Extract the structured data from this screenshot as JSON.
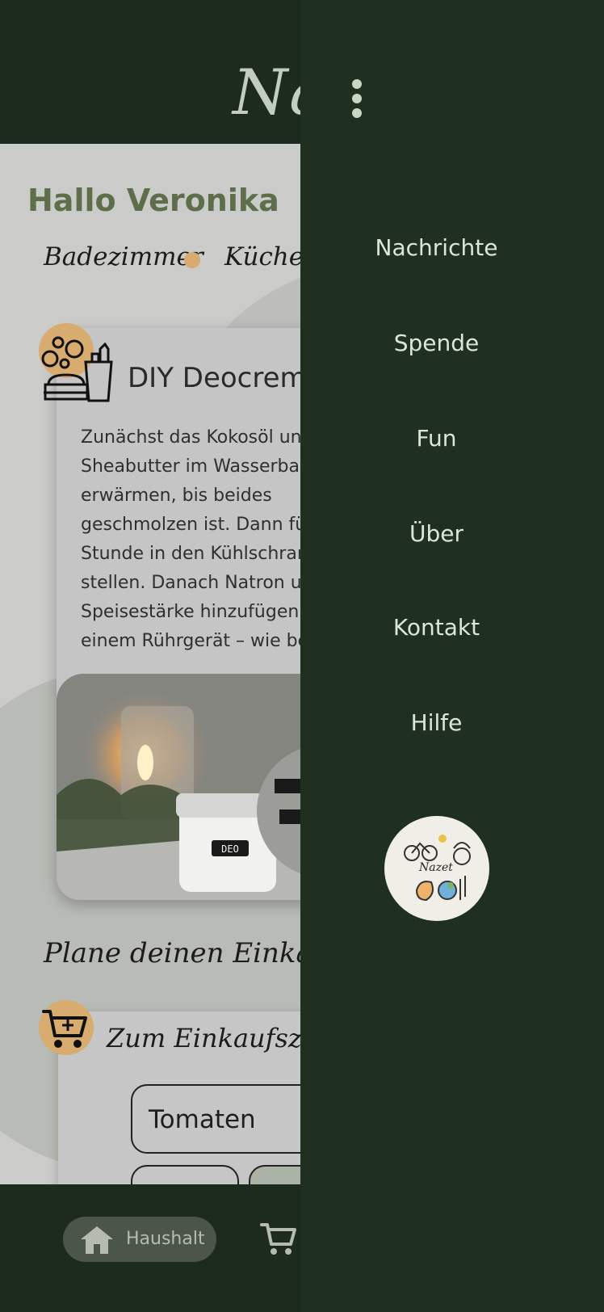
{
  "app": {
    "logo_text": "Na",
    "greeting": "Hallo Veronika"
  },
  "categories": [
    "Badezimmer",
    "Küche"
  ],
  "recipe_card": {
    "title": "DIY Deocreme",
    "text": "Zunächst das Kokosöl und Sheabutter im Wasserbad erwärmen, bis beides geschmolzen ist. Dann für eine Stunde in den Kühlschrank stellen. Danach Natron und Speisestärke hinzufügen und mit einem Rührgerät – wie beim",
    "image_icon": "bathroom-products-icon",
    "photo_label": "DEO"
  },
  "shopping": {
    "plan_heading": "Plane deinen Einkauf",
    "card_title": "Zum Einkaufszettel",
    "input_value": "Tomaten",
    "icon": "cart-plus-icon"
  },
  "bottom_nav": {
    "items": [
      {
        "label": "Haushalt",
        "icon": "home-icon",
        "active": true
      },
      {
        "label": "",
        "icon": "cart-icon",
        "active": false
      }
    ]
  },
  "drawer": {
    "menu_icon": "more-vertical-icon",
    "items": [
      {
        "label": "Nachrichte"
      },
      {
        "label": "Spende"
      },
      {
        "label": "Fun"
      },
      {
        "label": "Über"
      },
      {
        "label": "Kontakt"
      },
      {
        "label": "Hilfe"
      }
    ],
    "logo_text": "Nazet"
  },
  "colors": {
    "dark_green": "#1d2b1e",
    "drawer_green": "#203020",
    "accent_tan": "#d8ab6e",
    "greeting_green": "#5f6e4a"
  }
}
